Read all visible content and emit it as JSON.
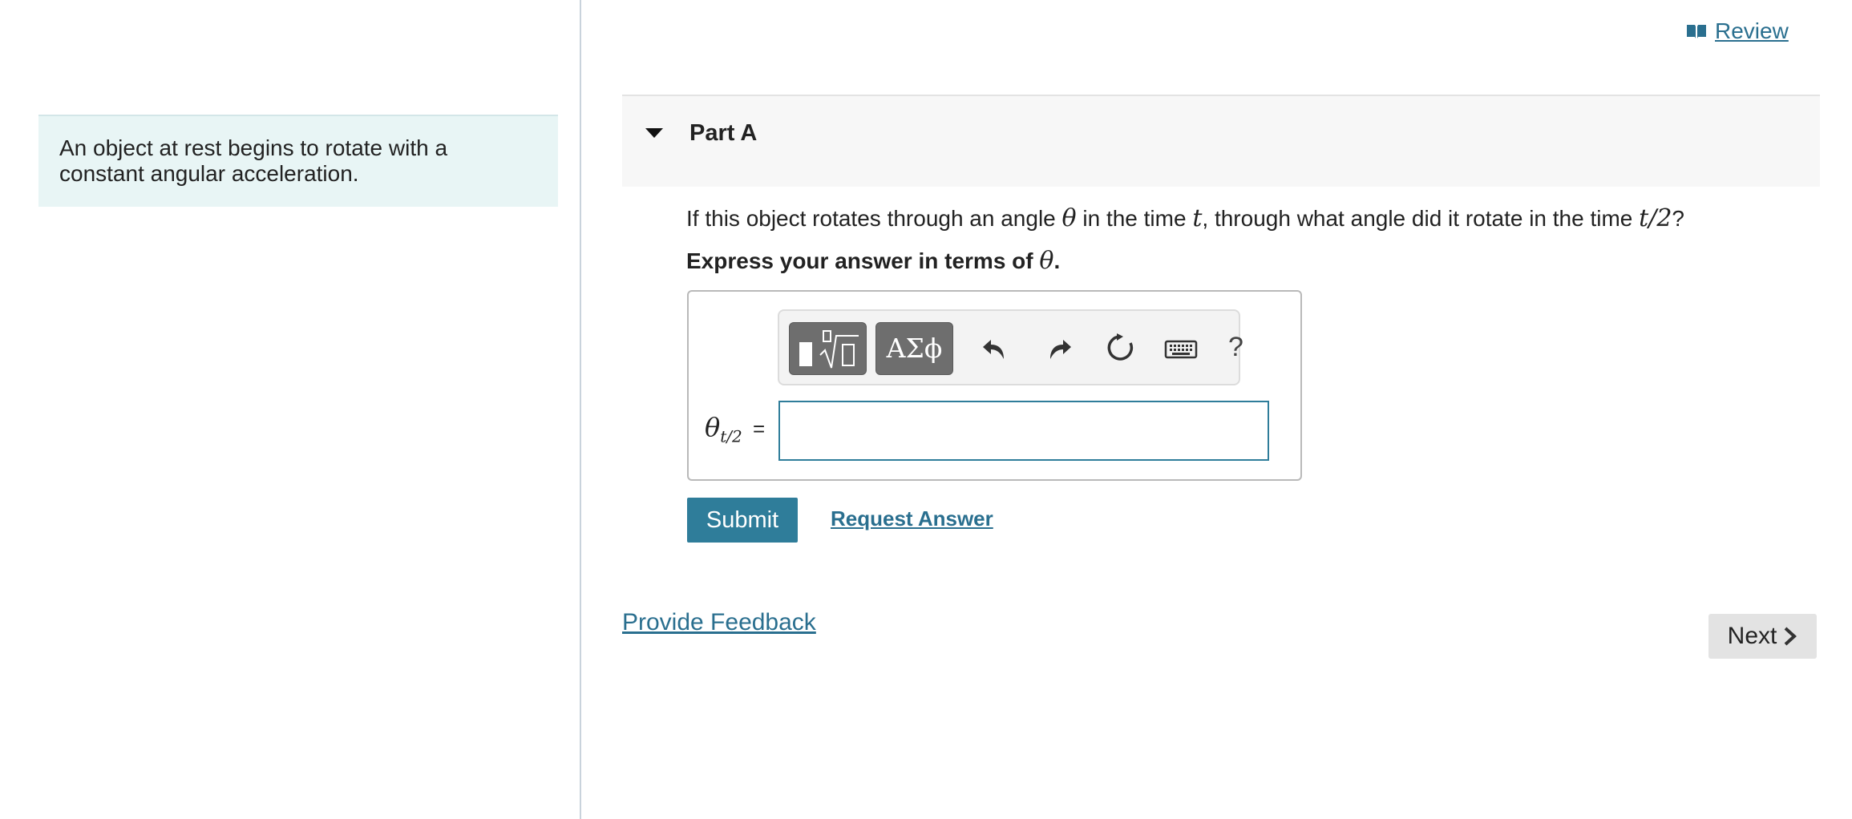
{
  "intro": {
    "text": "An object at rest begins to rotate with a constant angular acceleration."
  },
  "header": {
    "review_label": "Review"
  },
  "part": {
    "title": "Part A"
  },
  "question": {
    "text_1": "If this object rotates through an angle ",
    "theta": "θ",
    "text_2": " in the time ",
    "t": "t",
    "text_3": ", through what angle did it rotate in the time ",
    "t_half": "t/2",
    "text_4": "?"
  },
  "instruction": {
    "text": "Express your answer in terms of ",
    "theta": "θ",
    "period": "."
  },
  "toolbar": {
    "symbols_label": "ΑΣϕ",
    "help_label": "?"
  },
  "answer": {
    "label_main": "θ",
    "label_sub": "t/2",
    "equals": "=",
    "value": ""
  },
  "actions": {
    "submit_label": "Submit",
    "request_answer_label": "Request Answer",
    "feedback_label": "Provide Feedback",
    "next_label": "Next"
  },
  "colors": {
    "accent": "#2f7d9a",
    "link": "#2a6f8f",
    "intro_bg": "#e8f5f5",
    "header_bg": "#f7f7f7"
  }
}
